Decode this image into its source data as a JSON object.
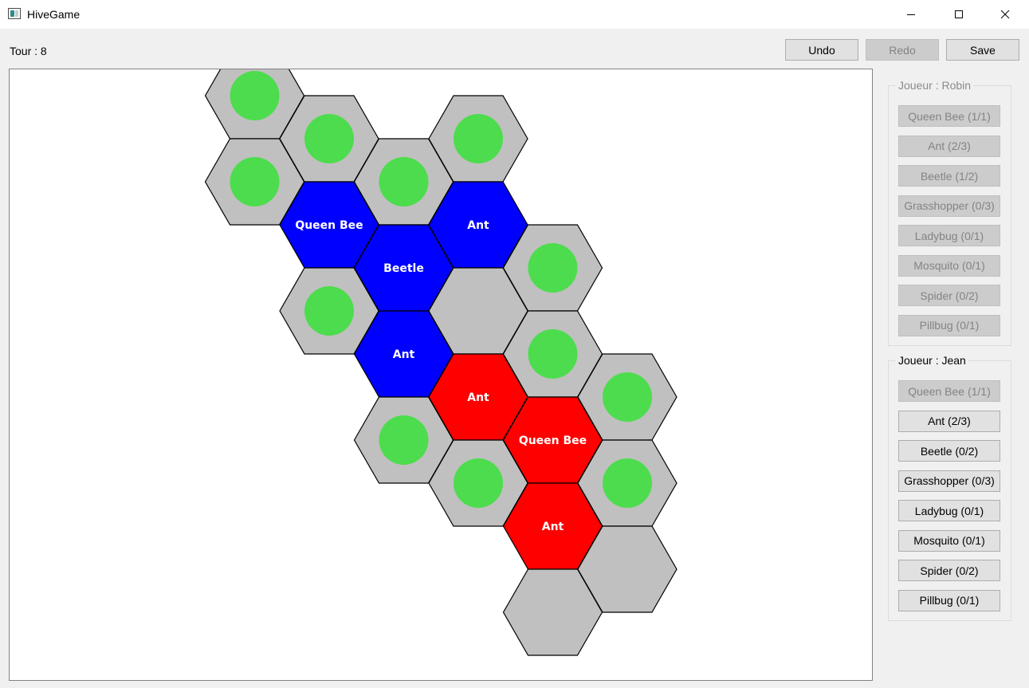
{
  "window": {
    "title": "HiveGame",
    "icon": "app-window-icon"
  },
  "toolbar": {
    "turn_text": "Tour : 8",
    "undo_label": "Undo",
    "redo_label": "Redo",
    "save_label": "Save"
  },
  "colors": {
    "player_blue": "#0000ff",
    "player_red": "#ff0000",
    "empty_tile": "#c0c0c0",
    "move_marker": "#4ddc4d"
  },
  "board": {
    "tiles": [
      {
        "q": 0,
        "r": -2,
        "owner": "empty",
        "label": "",
        "marker": true
      },
      {
        "q": -1,
        "r": -1,
        "owner": "empty",
        "label": "",
        "marker": true
      },
      {
        "q": 1,
        "r": -1,
        "owner": "empty",
        "label": "",
        "marker": true
      },
      {
        "q": -2,
        "r": -1,
        "owner": "empty",
        "label": "",
        "marker": true
      },
      {
        "q": 0,
        "r": -1,
        "owner": "blue",
        "label": "Ant",
        "marker": false
      },
      {
        "q": -3,
        "r": -1,
        "owner": "empty",
        "label": "",
        "marker": true
      },
      {
        "q": -1,
        "r": 0,
        "owner": "blue",
        "label": "Beetle",
        "marker": false
      },
      {
        "q": 1,
        "r": 0,
        "owner": "empty",
        "label": "",
        "marker": true
      },
      {
        "q": -2,
        "r": 0,
        "owner": "blue",
        "label": "Queen Bee",
        "marker": false
      },
      {
        "q": 0,
        "r": 0,
        "owner": "empty",
        "label": "",
        "marker": false
      },
      {
        "q": 2,
        "r": 0,
        "owner": "empty",
        "label": "",
        "marker": true
      },
      {
        "q": -3,
        "r": 0,
        "owner": "empty",
        "label": "",
        "marker": true
      },
      {
        "q": -1,
        "r": 1,
        "owner": "blue",
        "label": "Ant",
        "marker": false
      },
      {
        "q": 1,
        "r": 1,
        "owner": "red",
        "label": "Queen Bee",
        "marker": false
      },
      {
        "q": -2,
        "r": 1,
        "owner": "empty",
        "label": "",
        "marker": true
      },
      {
        "q": 0,
        "r": 1,
        "owner": "red",
        "label": "Ant",
        "marker": false
      },
      {
        "q": 2,
        "r": 1,
        "owner": "empty",
        "label": "",
        "marker": true
      },
      {
        "q": -1,
        "r": 2,
        "owner": "empty",
        "label": "",
        "marker": true
      },
      {
        "q": 1,
        "r": 2,
        "owner": "red",
        "label": "Ant",
        "marker": false
      },
      {
        "q": 0,
        "r": 2,
        "owner": "empty",
        "label": "",
        "marker": true
      },
      {
        "q": 2,
        "r": 2,
        "owner": "empty",
        "label": "",
        "marker": false
      },
      {
        "q": 1,
        "r": 3,
        "owner": "empty",
        "label": "",
        "marker": false
      }
    ]
  },
  "players": [
    {
      "title": "Joueur : Robin",
      "active": false,
      "pieces": [
        {
          "label": "Queen Bee (1/1)",
          "enabled": false
        },
        {
          "label": "Ant (2/3)",
          "enabled": false
        },
        {
          "label": "Beetle (1/2)",
          "enabled": false
        },
        {
          "label": "Grasshopper (0/3)",
          "enabled": false
        },
        {
          "label": "Ladybug (0/1)",
          "enabled": false
        },
        {
          "label": "Mosquito (0/1)",
          "enabled": false
        },
        {
          "label": "Spider (0/2)",
          "enabled": false
        },
        {
          "label": "Pillbug (0/1)",
          "enabled": false
        }
      ]
    },
    {
      "title": "Joueur : Jean",
      "active": true,
      "pieces": [
        {
          "label": "Queen Bee (1/1)",
          "enabled": false
        },
        {
          "label": "Ant (2/3)",
          "enabled": true
        },
        {
          "label": "Beetle (0/2)",
          "enabled": true
        },
        {
          "label": "Grasshopper (0/3)",
          "enabled": true
        },
        {
          "label": "Ladybug (0/1)",
          "enabled": true
        },
        {
          "label": "Mosquito (0/1)",
          "enabled": true
        },
        {
          "label": "Spider (0/2)",
          "enabled": true
        },
        {
          "label": "Pillbug (0/1)",
          "enabled": true
        }
      ]
    }
  ]
}
